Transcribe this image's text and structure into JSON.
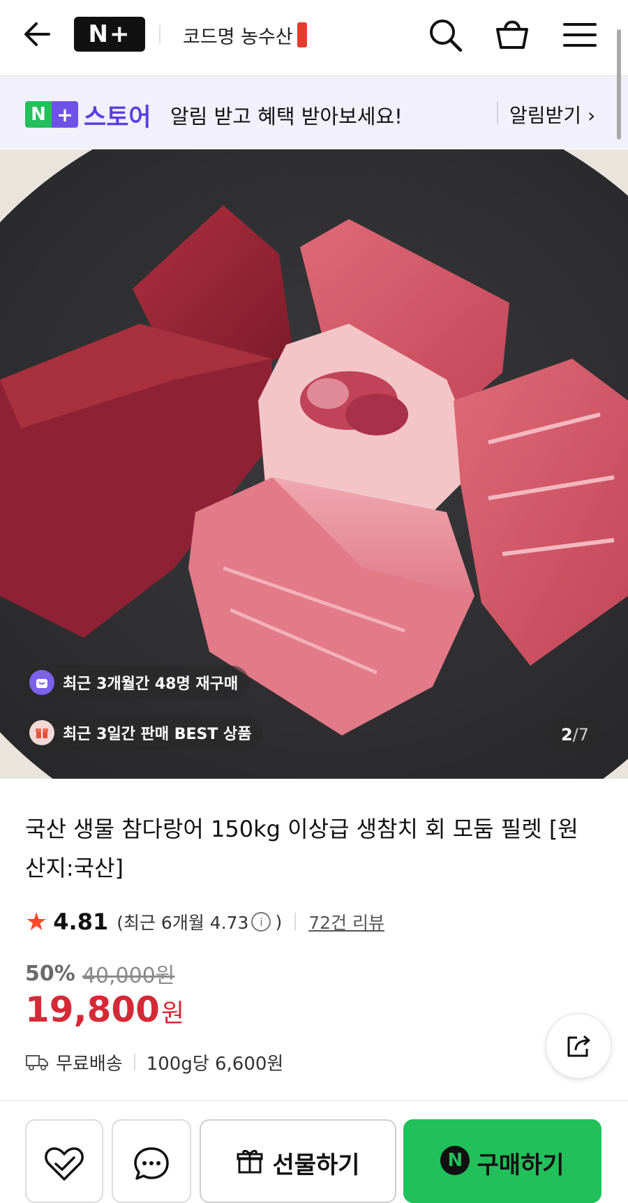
{
  "header": {
    "logo_text": "N+",
    "store_name": "코드명 농수산",
    "icons": [
      "back-arrow-icon",
      "search-icon",
      "shopping-bag-icon",
      "hamburger-menu-icon"
    ]
  },
  "banner": {
    "logo_n": "N",
    "logo_plus": "+",
    "store_label": "스토어",
    "message": "알림 받고 혜택 받아보세요!",
    "link_label": "알림받기 ›"
  },
  "hero": {
    "badge_repurchase": "최근 3개월간 48명 재구매",
    "badge_best": "최근 3일간 판매 BEST 상품",
    "image_index": "2",
    "image_total": "/7"
  },
  "product": {
    "title": "국산 생물 참다랑어 150kg 이상급 생참치 회 모둠 필렛 [원산지:국산]",
    "rating": "4.81",
    "rating_recent_prefix": "(최근 6개월 4.73",
    "rating_recent_suffix": ")",
    "review_count": "72건 리뷰",
    "discount_percent": "50%",
    "original_price": "40,000원",
    "sale_price": "19,800",
    "sale_price_unit": "원",
    "shipping": "무료배송",
    "unit_price": "100g당 6,600원"
  },
  "actions": {
    "gift_label": "선물하기",
    "buy_label": "구매하기",
    "buy_logo": "N"
  },
  "colors": {
    "brand_green": "#21c05a",
    "brand_purple": "#6e52e6",
    "price_red": "#d42a37",
    "star_red": "#ff4b2b",
    "banner_bg": "#f1f0fb"
  }
}
